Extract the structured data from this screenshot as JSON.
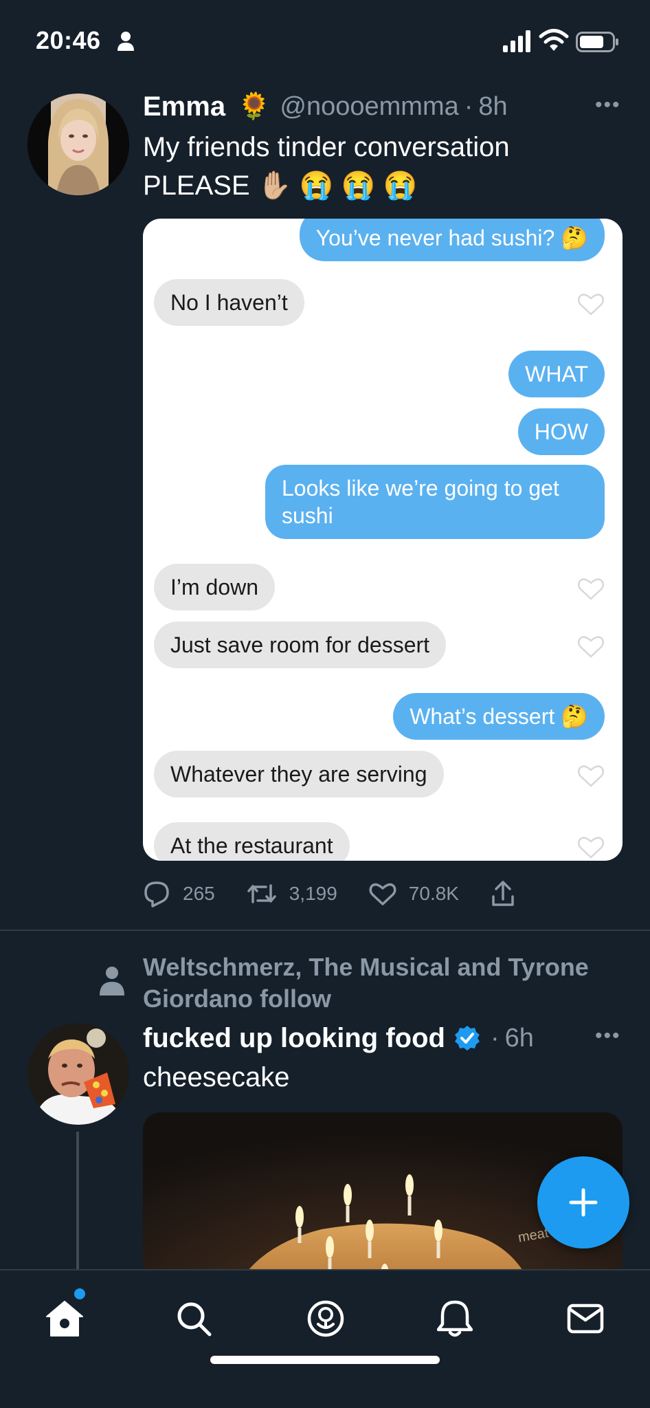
{
  "status_bar": {
    "time": "20:46"
  },
  "tweet1": {
    "name": "Emma",
    "name_emoji": "🌻",
    "handle": "@noooemmma",
    "separator": "·",
    "time": "8h",
    "more": "•••",
    "text_line1": "My friends tinder conversation",
    "text_line2": "PLEASE",
    "text_emojis": "✋🏼 😭 😭 😭",
    "chat": {
      "messages": [
        {
          "dir": "out",
          "text": "You’ve never had sushi? 🤔"
        },
        {
          "dir": "in",
          "text": "No I haven’t"
        },
        {
          "dir": "out",
          "text": "WHAT"
        },
        {
          "dir": "out",
          "text": "HOW"
        },
        {
          "dir": "out",
          "text": "Looks like we’re going to get"
        },
        {
          "dir": "out",
          "text": "sushi"
        },
        {
          "dir": "in",
          "text": "I’m down"
        },
        {
          "dir": "in",
          "text": "Just save room for dessert"
        },
        {
          "dir": "out",
          "text": "What’s dessert 🤔"
        },
        {
          "dir": "in",
          "text": "Whatever they are serving"
        },
        {
          "dir": "in",
          "text": "At the restaurant"
        }
      ]
    },
    "stats": {
      "replies": "265",
      "retweets": "3,199",
      "likes": "70.8K"
    }
  },
  "tweet2": {
    "social_context": "Weltschmerz, The Musical and Tyrone Giordano follow",
    "name": "fucked up looking food",
    "separator": "·",
    "time": "6h",
    "more": "•••",
    "text": "cheesecake",
    "watermark": "meat"
  },
  "icons": {
    "nav": [
      "home-icon",
      "search-icon",
      "spaces-icon",
      "notifications-icon",
      "messages-icon"
    ],
    "fab": "compose-plus-icon"
  },
  "colors": {
    "background": "#15202b",
    "accent": "#1d9bf0",
    "muted": "#8b98a5",
    "bubble_out": "#5ab1f0",
    "bubble_in": "#e6e6e6"
  }
}
